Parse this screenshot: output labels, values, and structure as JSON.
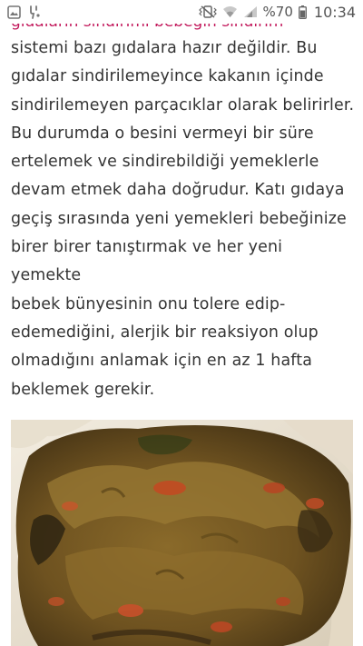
{
  "status_bar": {
    "battery_percent": "%70",
    "time": "10:34",
    "icons": [
      "gallery-icon",
      "notification-icon",
      "vibrate-mute-icon",
      "wifi-icon",
      "signal-icon",
      "battery-icon"
    ]
  },
  "article": {
    "partial_line": "gıdaların sindirimi bebeğin sindirim",
    "lines": [
      "sistemi bazı gıdalara hazır değildir. Bu",
      "gıdalar sindirilemeyince kakanın içinde",
      "sindirilemeyen parçacıklar olarak belirirler.",
      "Bu durumda o besini vermeyi bir süre",
      "ertelemek ve sindirebildiği yemeklerle",
      "devam etmek daha doğrudur. Katı gıdaya",
      "geçiş sırasında yeni yemekleri bebeğinize",
      "birer birer tanıştırmak ve her yeni yemekte",
      "bebek bünyesinin onu tolere edip-",
      "edemediğini, alerjik  bir reaksiyon olup",
      "olmadığını anlamak için en az 1 hafta",
      "beklemek gerekir."
    ]
  },
  "colors": {
    "text": "#333333",
    "accent": "#c2185b",
    "status_icons": "#555555"
  },
  "image": {
    "subject": "baby-stool-photo"
  }
}
